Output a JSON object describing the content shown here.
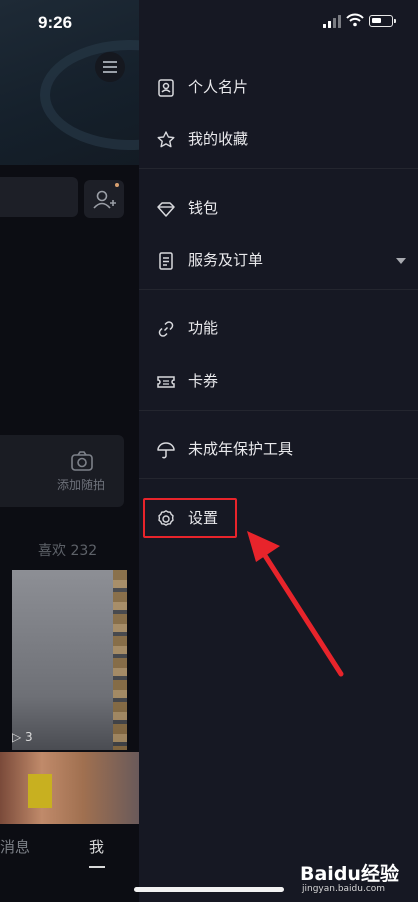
{
  "status_bar": {
    "time": "9:26"
  },
  "profile_bg": {
    "camera_label": "添加随拍",
    "likes": "喜欢 232",
    "play_count": "3",
    "tabs": {
      "messages": "消息",
      "me": "我"
    }
  },
  "drawer": {
    "items": [
      {
        "label": "个人名片",
        "icon": "id-card-icon"
      },
      {
        "label": "我的收藏",
        "icon": "star-icon"
      },
      {
        "label": "钱包",
        "icon": "diamond-icon"
      },
      {
        "label": "服务及订单",
        "icon": "document-icon",
        "expandable": true
      },
      {
        "label": "功能",
        "icon": "link-icon"
      },
      {
        "label": "卡券",
        "icon": "ticket-icon"
      },
      {
        "label": "未成年保护工具",
        "icon": "umbrella-icon"
      },
      {
        "label": "设置",
        "icon": "gear-icon"
      }
    ]
  },
  "annotation": {
    "highlight_color": "#e8242b",
    "target": "设置"
  },
  "watermark": {
    "brand": "Baidu经验",
    "url": "jingyan.baidu.com"
  }
}
